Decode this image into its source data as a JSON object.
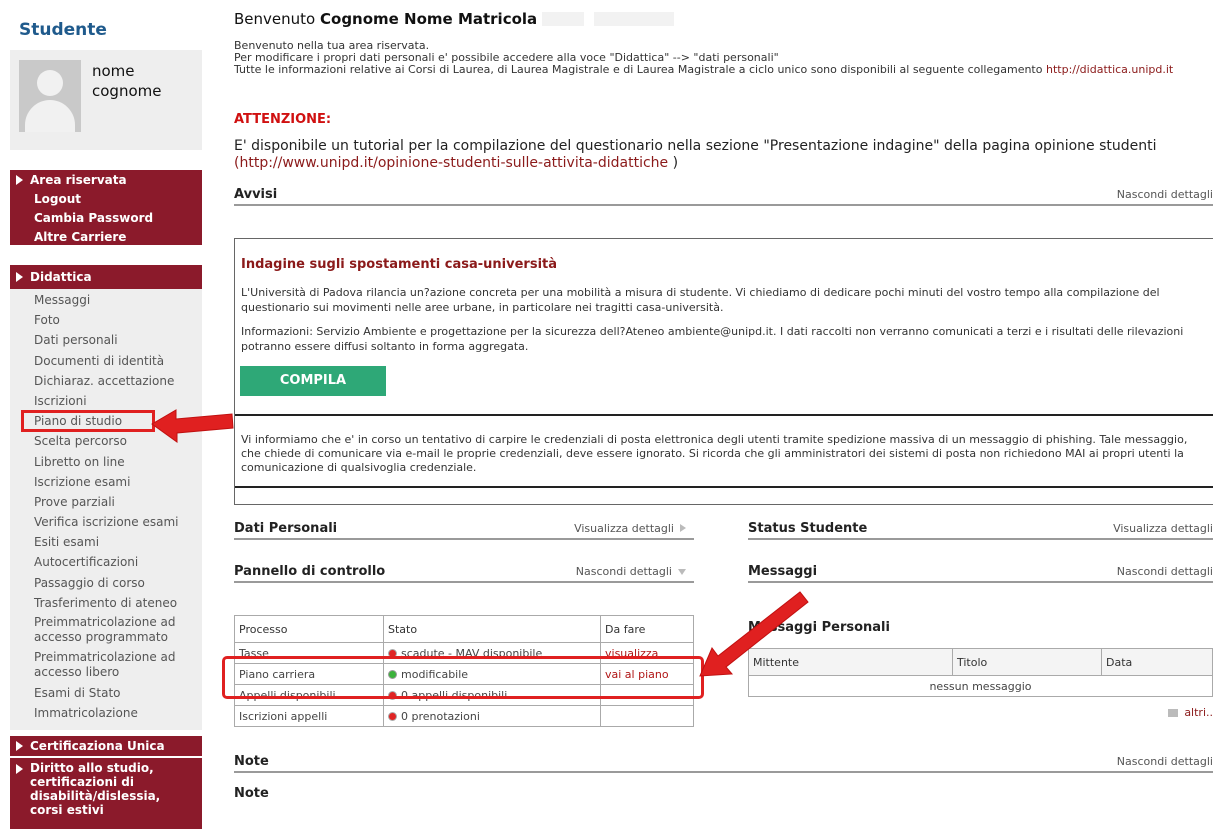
{
  "sidebar": {
    "title": "Studente",
    "profile": {
      "first_name": "nome",
      "last_name": "cognome"
    },
    "area_riservata": {
      "header": "Area riservata",
      "items": [
        "Logout",
        "Cambia Password",
        "Altre Carriere"
      ]
    },
    "didattica": {
      "header": "Didattica",
      "items": [
        "Messaggi",
        "Foto",
        "Dati personali",
        "Documenti di identità",
        "Dichiaraz. accettazione",
        "Iscrizioni",
        "Piano di studio",
        "Scelta percorso",
        "Libretto on line",
        "Iscrizione esami",
        "Prove parziali",
        "Verifica iscrizione esami",
        "Esiti esami",
        "Autocertificazioni",
        "Passaggio di corso",
        "Trasferimento di ateneo",
        "Preimmatricolazione ad accesso programmato",
        "Preimmatricolazione ad accesso libero",
        "Esami di Stato",
        "Immatricolazione"
      ]
    },
    "certificazione": {
      "header": "Certificaziona Unica"
    },
    "diritto": {
      "header": "Diritto allo studio, certificazioni di disabilità/dislessia, corsi estivi"
    }
  },
  "main": {
    "welcome": {
      "prefix": "Benvenuto",
      "name": "Cognome Nome Matricola"
    },
    "intro": {
      "line1": "Benvenuto nella tua area riservata.",
      "line2": "Per modificare i propri dati personali e' possibile accedere alla voce \"Didattica\" --> \"dati personali\"",
      "line3": "Tutte le informazioni relative ai Corsi di Laurea, di Laurea Magistrale e di Laurea Magistrale a ciclo unico sono disponibili al seguente collegamento",
      "link": "http://didattica.unipd.it"
    },
    "attention": "ATTENZIONE:",
    "tutorial": {
      "text": "E' disponibile un tutorial per la compilazione del questionario nella sezione \"Presentazione indagine\" della pagina opinione studenti",
      "link": "(http://www.unipd.it/opinione-studenti-sulle-attivita-didattiche",
      "close": " )"
    },
    "avvisi": {
      "title": "Avvisi",
      "action": "Nascondi dettagli",
      "survey_title": "Indagine sugli spostamenti casa-università",
      "survey_p1": "L'Università di Padova rilancia un?azione concreta per una mobilità a misura di studente. Vi chiediamo di dedicare pochi minuti del vostro tempo alla compilazione del questionario sui movimenti nelle aree urbane, in particolare nei tragitti casa-università.",
      "survey_p2": "Informazioni: Servizio Ambiente e progettazione per la sicurezza dell?Ateneo ambiente@unipd.it. I dati raccolti non verranno comunicati a terzi e i risultati delle rilevazioni potranno essere diffusi soltanto in forma aggregata.",
      "compila": "COMPILA",
      "phishing": "Vi informiamo che e' in corso un tentativo di carpire le credenziali di posta elettronica degli utenti tramite spedizione massiva di un messaggio di phishing. Tale messaggio, che chiede di comunicare via e-mail le proprie credenziali, deve essere ignorato. Si ricorda che gli amministratori dei sistemi di posta non richiedono MAI ai propri utenti la comunicazione di qualsivoglia credenziale."
    },
    "dati_personali": {
      "title": "Dati Personali",
      "action": "Visualizza dettagli"
    },
    "status_studente": {
      "title": "Status Studente",
      "action": "Visualizza dettagli"
    },
    "pannello": {
      "title": "Pannello di controllo",
      "action": "Nascondi dettagli",
      "headers": [
        "Processo",
        "Stato",
        "Da fare"
      ],
      "rows": [
        {
          "process": "Tasse",
          "status": "scadute - MAV disponibile",
          "status_color": "red",
          "todo": "visualizza"
        },
        {
          "process": "Piano carriera",
          "status": "modificabile",
          "status_color": "green",
          "todo": "vai al piano"
        },
        {
          "process": "Appelli disponibili",
          "status": "0 appelli disponibili",
          "status_color": "red",
          "todo": ""
        },
        {
          "process": "Iscrizioni appelli",
          "status": "0 prenotazioni",
          "status_color": "red",
          "todo": ""
        }
      ]
    },
    "messaggi": {
      "title": "Messaggi",
      "action": "Nascondi dettagli",
      "personal_title": "Messaggi Personali",
      "headers": [
        "Mittente",
        "Titolo",
        "Data"
      ],
      "empty": "nessun messaggio",
      "more": "altri.."
    },
    "note": {
      "title": "Note",
      "action": "Nascondi dettagli",
      "label": "Note"
    }
  },
  "colors": {
    "brand_red": "#8b1a2b",
    "accent_green": "#2ea877",
    "annotation_red": "#e02020",
    "title_blue": "#1f5a8c"
  }
}
